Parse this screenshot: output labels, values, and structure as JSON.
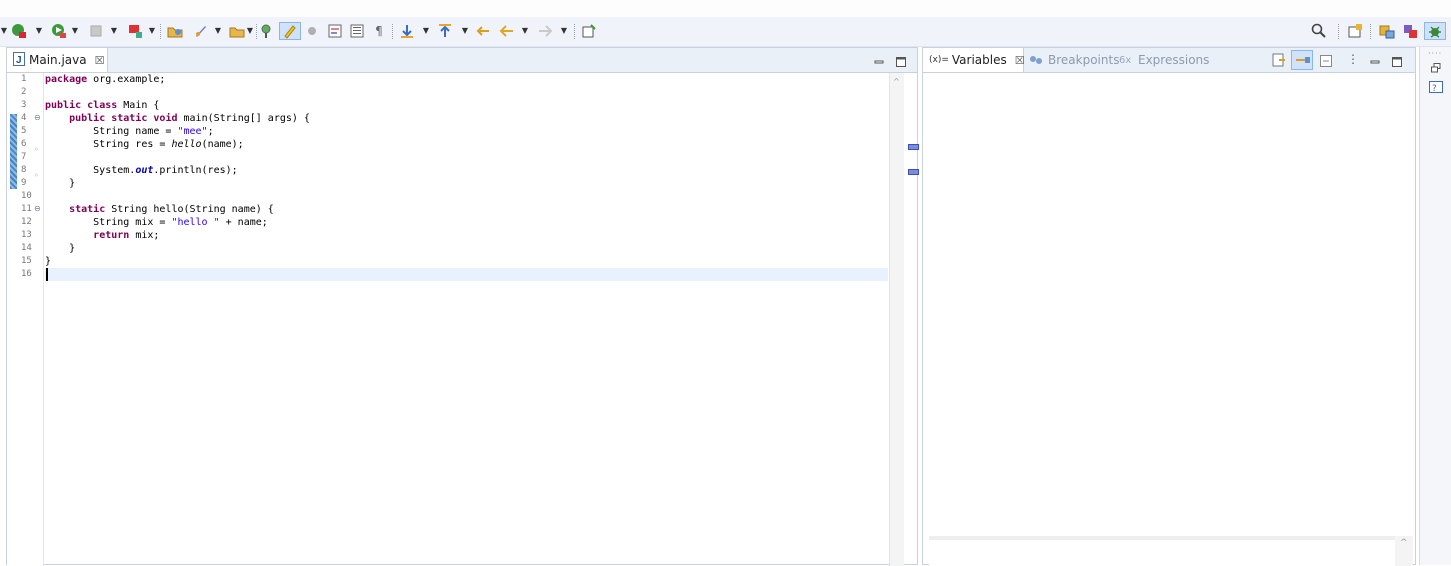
{
  "editor": {
    "tab_label": "Main.java",
    "tab_close": "☒",
    "lines": [
      {
        "n": "1",
        "parts": [
          {
            "t": "package",
            "c": "kw"
          },
          {
            "t": " org.example;",
            "c": "tx"
          }
        ]
      },
      {
        "n": "2",
        "parts": []
      },
      {
        "n": "3",
        "parts": [
          {
            "t": "public",
            "c": "kw"
          },
          {
            "t": " ",
            "c": "tx"
          },
          {
            "t": "class",
            "c": "kw"
          },
          {
            "t": " Main {",
            "c": "tx"
          }
        ]
      },
      {
        "n": "4",
        "fold": "⊖",
        "parts": [
          {
            "t": "    ",
            "c": "tx"
          },
          {
            "t": "public",
            "c": "kw"
          },
          {
            "t": " ",
            "c": "tx"
          },
          {
            "t": "static",
            "c": "kw"
          },
          {
            "t": " ",
            "c": "tx"
          },
          {
            "t": "void",
            "c": "kw"
          },
          {
            "t": " main(String[] args) {",
            "c": "tx"
          }
        ]
      },
      {
        "n": "5",
        "parts": [
          {
            "t": "        String name = ",
            "c": "tx"
          },
          {
            "t": "\"mee\"",
            "c": "str"
          },
          {
            "t": ";",
            "c": "tx"
          }
        ]
      },
      {
        "n": "6",
        "parts": [
          {
            "t": "        String res = ",
            "c": "tx"
          },
          {
            "t": "hello",
            "c": "it"
          },
          {
            "t": "(name);",
            "c": "tx"
          }
        ]
      },
      {
        "n": "7",
        "parts": []
      },
      {
        "n": "8",
        "parts": [
          {
            "t": "        System.",
            "c": "tx"
          },
          {
            "t": "out",
            "c": "fld"
          },
          {
            "t": ".println(res);",
            "c": "tx"
          }
        ]
      },
      {
        "n": "9",
        "parts": [
          {
            "t": "    }",
            "c": "tx"
          }
        ]
      },
      {
        "n": "10",
        "parts": []
      },
      {
        "n": "11",
        "fold": "⊖",
        "parts": [
          {
            "t": "    ",
            "c": "tx"
          },
          {
            "t": "static",
            "c": "kw"
          },
          {
            "t": " String hello(String name) {",
            "c": "tx"
          }
        ]
      },
      {
        "n": "12",
        "parts": [
          {
            "t": "        String mix = ",
            "c": "tx"
          },
          {
            "t": "\"hello \"",
            "c": "str"
          },
          {
            "t": " + name;",
            "c": "tx"
          }
        ]
      },
      {
        "n": "13",
        "parts": [
          {
            "t": "        ",
            "c": "tx"
          },
          {
            "t": "return",
            "c": "kw"
          },
          {
            "t": " mix;",
            "c": "tx"
          }
        ]
      },
      {
        "n": "14",
        "parts": [
          {
            "t": "    }",
            "c": "tx"
          }
        ]
      },
      {
        "n": "15",
        "parts": [
          {
            "t": "}",
            "c": "tx"
          }
        ]
      },
      {
        "n": "16",
        "parts": []
      }
    ]
  },
  "variables_view": {
    "tab_icon": "(x)=",
    "tab_label": "Variables",
    "tab_close": "☒",
    "breakpoints_label": "Breakpoints",
    "expressions_label": "Expressions"
  },
  "colors": {
    "keyword": "#7f0055",
    "string": "#2a00ff",
    "field": "#0000c0",
    "text": "#000000"
  }
}
